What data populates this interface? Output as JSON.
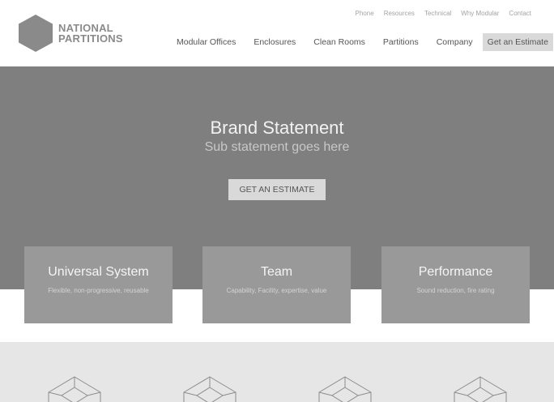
{
  "brand": {
    "line1": "NATIONAL",
    "line2": "PARTITIONS",
    "icon": "hexagon-logo-icon"
  },
  "utility_nav": [
    "Phone",
    "Resources",
    "Technical",
    "Why Modular",
    "Contact"
  ],
  "main_nav": {
    "items": [
      "Modular Offices",
      "Enclosures",
      "Clean Rooms",
      "Partitions",
      "Company"
    ],
    "cta_label": "Get an Estimate"
  },
  "hero": {
    "title": "Brand Statement",
    "subtitle": "Sub statement goes here",
    "button_label": "GET AN ESTIMATE"
  },
  "features": [
    {
      "title": "Universal System",
      "desc": "Flexible, non-progressive, reusable"
    },
    {
      "title": "Team",
      "desc": "Capability, Facility, expertise, value"
    },
    {
      "title": "Performance",
      "desc": "Sound reduction, fire rating"
    }
  ],
  "band_icons": [
    "cube-icon",
    "cube-icon",
    "cube-icon",
    "cube-icon"
  ],
  "colors": {
    "hero_bg": "#7f7f7f",
    "card_bg": "#999999",
    "button_bg": "#d9d9d9",
    "band_bg": "#e6e6e6",
    "logo": "#8a8a8a"
  }
}
